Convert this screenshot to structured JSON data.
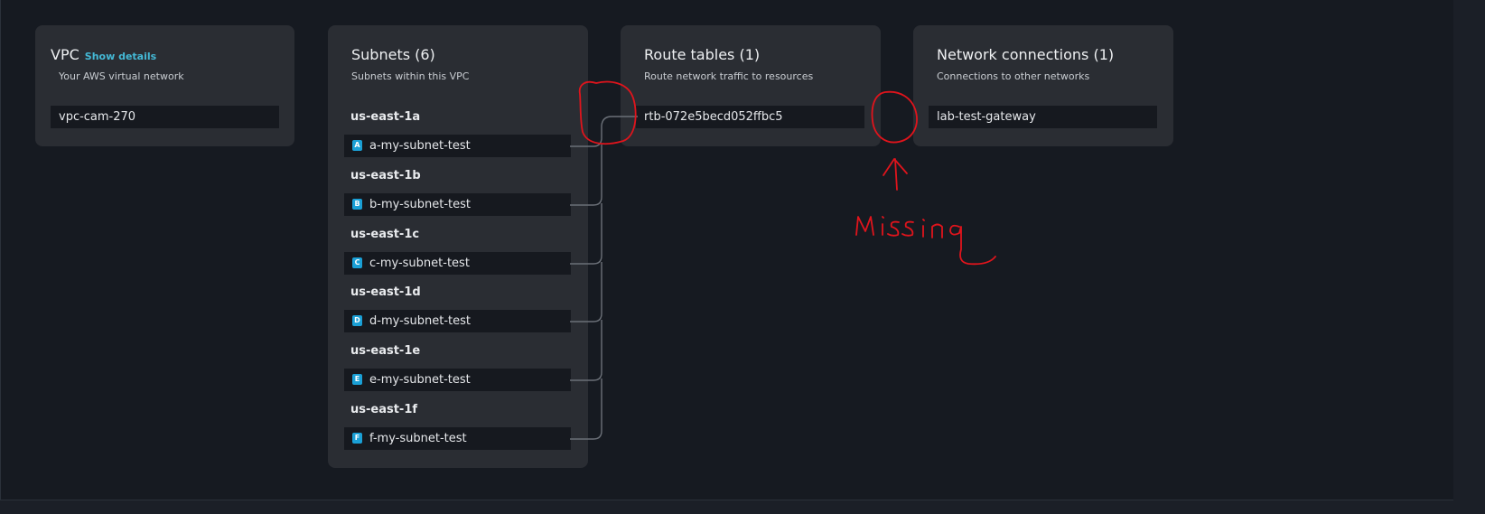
{
  "vpc": {
    "title": "VPC",
    "show_details": "Show details",
    "subtitle": "Your AWS virtual network",
    "value": "vpc-cam-270"
  },
  "subnets": {
    "title": "Subnets (6)",
    "subtitle": "Subnets within this VPC",
    "zones": [
      {
        "az": "us-east-1a",
        "badge": "A",
        "name": "a-my-subnet-test"
      },
      {
        "az": "us-east-1b",
        "badge": "B",
        "name": "b-my-subnet-test"
      },
      {
        "az": "us-east-1c",
        "badge": "C",
        "name": "c-my-subnet-test"
      },
      {
        "az": "us-east-1d",
        "badge": "D",
        "name": "d-my-subnet-test"
      },
      {
        "az": "us-east-1e",
        "badge": "E",
        "name": "e-my-subnet-test"
      },
      {
        "az": "us-east-1f",
        "badge": "F",
        "name": "f-my-subnet-test"
      }
    ]
  },
  "route_tables": {
    "title": "Route tables (1)",
    "subtitle": "Route network traffic to resources",
    "value": "rtb-072e5becd052ffbc5"
  },
  "network_connections": {
    "title": "Network connections (1)",
    "subtitle": "Connections to other networks",
    "value": "lab-test-gateway"
  },
  "annotation": {
    "text": "Missing",
    "color": "#e0141c"
  },
  "colors": {
    "accent": "#44b9d6",
    "subnet_icon": "#1aa0d6",
    "card_bg": "#2a2d33",
    "page_bg": "#161a21"
  }
}
